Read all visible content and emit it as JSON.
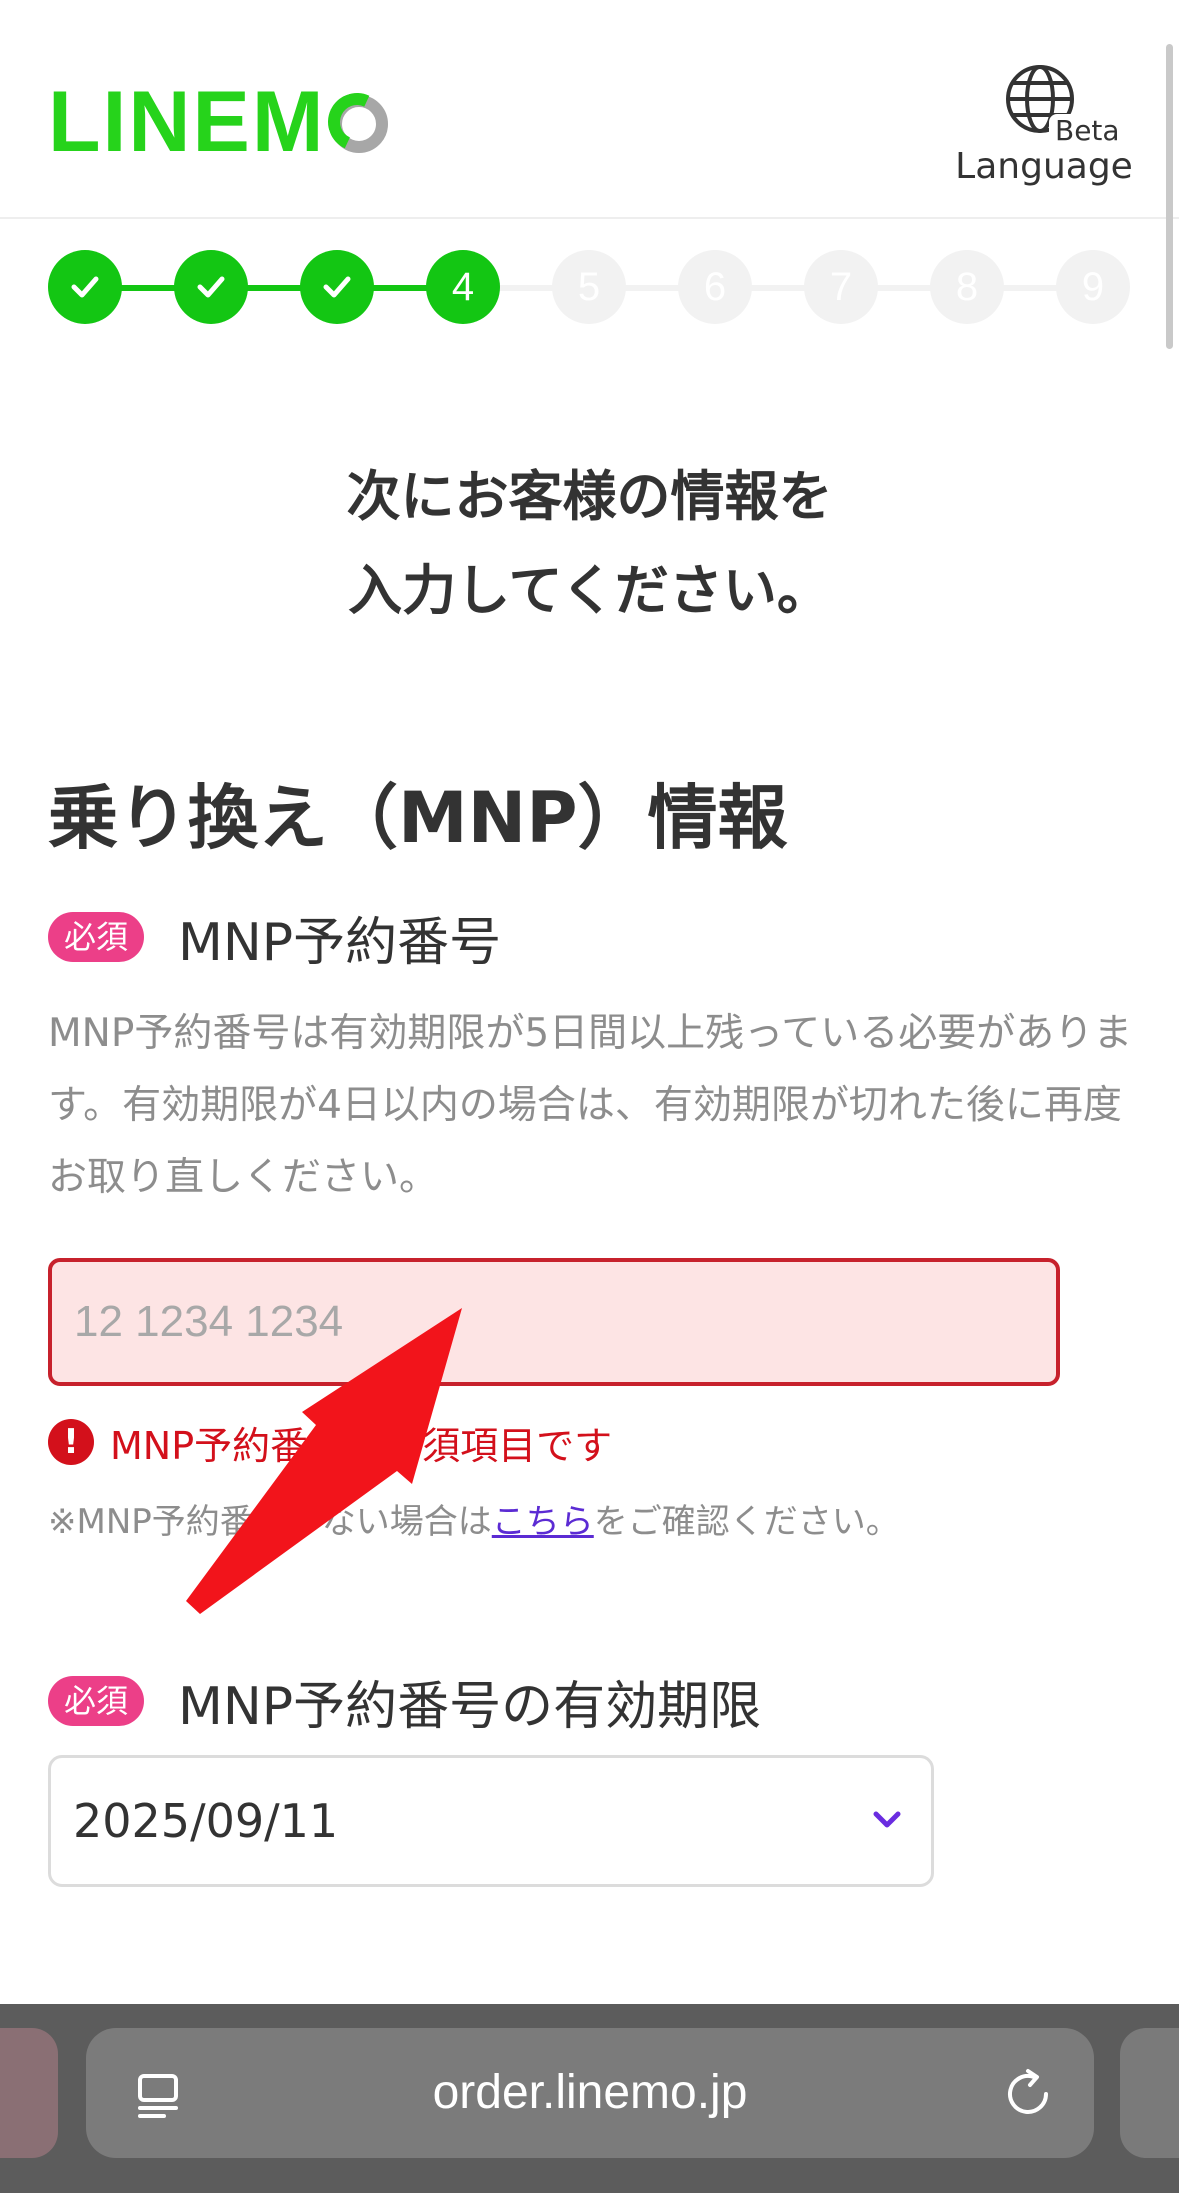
{
  "header": {
    "logo": "LINEM",
    "language_label": "Language",
    "beta_label": "Beta"
  },
  "steps": [
    {
      "label": "",
      "state": "done"
    },
    {
      "label": "",
      "state": "done"
    },
    {
      "label": "",
      "state": "done"
    },
    {
      "label": "4",
      "state": "current"
    },
    {
      "label": "5",
      "state": "todo"
    },
    {
      "label": "6",
      "state": "todo"
    },
    {
      "label": "7",
      "state": "todo"
    },
    {
      "label": "8",
      "state": "todo"
    },
    {
      "label": "9",
      "state": "todo"
    }
  ],
  "headline": {
    "line1": "次にお客様の情報を",
    "line2": "入力してください。"
  },
  "section": {
    "title": "乗り換え（MNP）情報"
  },
  "mnp_number": {
    "required_badge": "必須",
    "label": "MNP予約番号",
    "description": "MNP予約番号は有効期限が5日間以上残っている必要があります。有効期限が4日以内の場合は、有効期限が切れた後に再度お取り直しください。",
    "value": "",
    "placeholder": "12 1234 1234",
    "error_icon": "!",
    "error": "MNP予約番号は必須項目です",
    "note_prefix": "※MNP予約番号がない場合は",
    "note_link": "こちら",
    "note_suffix": "をご確認ください。"
  },
  "mnp_expiry": {
    "required_badge": "必須",
    "label": "MNP予約番号の有効期限",
    "selected": "2025/09/11"
  },
  "browser": {
    "url": "order.linemo.jp"
  },
  "colors": {
    "brand_green": "#26d31b",
    "step_green": "#13c613",
    "required_pink": "#ec3f88",
    "error_red": "#d3101b",
    "link_purple": "#5b2bd3",
    "annotation_arrow": "#f2141b"
  },
  "icons": [
    "globe-icon",
    "check-icon",
    "error-icon",
    "chevron-down-icon",
    "tabs-icon",
    "reload-icon",
    "annotation-arrow"
  ]
}
